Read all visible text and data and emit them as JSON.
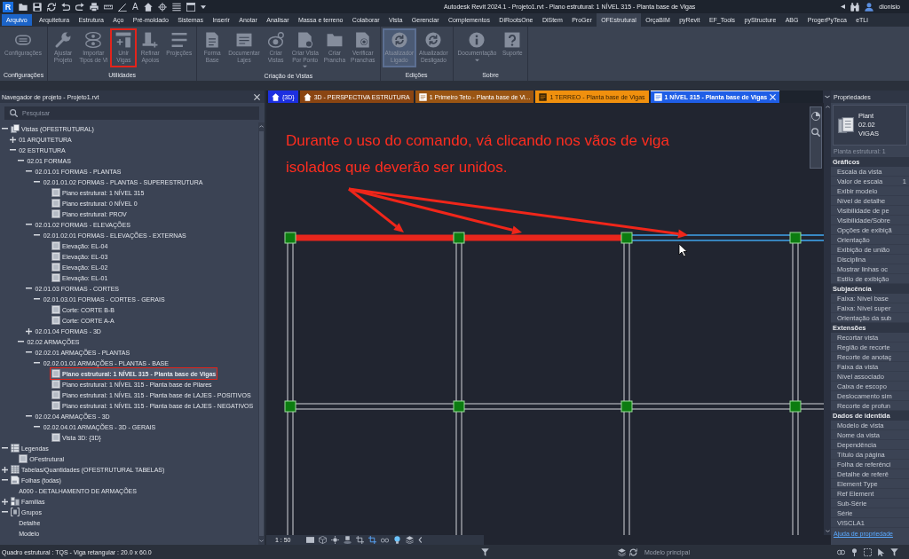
{
  "title_bar": {
    "logo": "R",
    "text_tool": "A",
    "title": "Autodesk Revit 2024.1 - Projeto1.rvt - Plano estrutural: 1 NÍVEL 315 - Planta base de Vigas",
    "user": "dionisio"
  },
  "menu": {
    "file_button": "Arquivo",
    "tabs": [
      {
        "label": "Arquitetura",
        "selected": false
      },
      {
        "label": "Estrutura",
        "selected": false
      },
      {
        "label": "Aço",
        "selected": false
      },
      {
        "label": "Pré-moldado",
        "selected": false
      },
      {
        "label": "Sistemas",
        "selected": false
      },
      {
        "label": "Inserir",
        "selected": false
      },
      {
        "label": "Anotar",
        "selected": false
      },
      {
        "label": "Analisar",
        "selected": false
      },
      {
        "label": "Massa e terreno",
        "selected": false
      },
      {
        "label": "Colaborar",
        "selected": false
      },
      {
        "label": "Vista",
        "selected": false
      },
      {
        "label": "Gerenciar",
        "selected": false
      },
      {
        "label": "Complementos",
        "selected": false
      },
      {
        "label": "DiRootsOne",
        "selected": false
      },
      {
        "label": "DiStem",
        "selected": false
      },
      {
        "label": "ProGer",
        "selected": false
      },
      {
        "label": "OFEstrutural",
        "selected": true
      },
      {
        "label": "OrçaBIM",
        "selected": false
      },
      {
        "label": "pyRevit",
        "selected": false
      },
      {
        "label": "EF_Tools",
        "selected": false
      },
      {
        "label": "pyStructure",
        "selected": false
      },
      {
        "label": "ABG",
        "selected": false
      },
      {
        "label": "ProgerPyTeca",
        "selected": false
      },
      {
        "label": "eTLi",
        "selected": false
      }
    ]
  },
  "ribbon": {
    "panels": [
      {
        "title": "Configurações",
        "buttons": [
          {
            "label": "Configurações",
            "disabled": true,
            "pressed": false,
            "annotated": false,
            "menu": false
          }
        ]
      },
      {
        "title": "Utilidades",
        "buttons": [
          {
            "label": "Ajustar\nProjeto",
            "disabled": true,
            "pressed": false,
            "annotated": false,
            "menu": false
          },
          {
            "label": "Importar\nTipos de Vi",
            "disabled": true,
            "pressed": false,
            "annotated": false,
            "menu": false
          },
          {
            "label": "Unir\nVigas",
            "disabled": true,
            "pressed": false,
            "annotated": true,
            "menu": false
          },
          {
            "label": "Refinar\nApoios",
            "disabled": true,
            "pressed": false,
            "annotated": false,
            "menu": false
          },
          {
            "label": "Projeções",
            "disabled": true,
            "pressed": false,
            "annotated": false,
            "menu": false
          }
        ]
      },
      {
        "title": "Criação de Vistas",
        "buttons": [
          {
            "label": "Forma\nBase",
            "disabled": true,
            "pressed": false,
            "annotated": false,
            "menu": false
          },
          {
            "label": "Documentar\nLajes",
            "disabled": true,
            "pressed": false,
            "annotated": false,
            "menu": false
          },
          {
            "label": "Criar\nVistas",
            "disabled": true,
            "pressed": false,
            "annotated": false,
            "menu": false
          },
          {
            "label": "Criar Vista\nPor Ponto",
            "disabled": true,
            "pressed": false,
            "annotated": false,
            "menu": true
          },
          {
            "label": "Criar\nPrancha",
            "disabled": true,
            "pressed": false,
            "annotated": false,
            "menu": false
          },
          {
            "label": "Verificar\nPranchas",
            "disabled": true,
            "pressed": false,
            "annotated": false,
            "menu": false
          }
        ]
      },
      {
        "title": "Edições",
        "buttons": [
          {
            "label": "Atualizador\nLigado",
            "disabled": true,
            "pressed": true,
            "annotated": false,
            "menu": false
          },
          {
            "label": "Atualizador\nDesligado",
            "disabled": true,
            "pressed": false,
            "annotated": false,
            "menu": false
          }
        ]
      },
      {
        "title": "Sobre",
        "buttons": [
          {
            "label": "Documentação",
            "disabled": true,
            "pressed": false,
            "annotated": false,
            "menu": true
          },
          {
            "label": "Suporte",
            "disabled": true,
            "pressed": false,
            "annotated": false,
            "menu": false
          }
        ]
      }
    ]
  },
  "project_browser": {
    "title": "Navegador de projeto - Projeto1.rvt",
    "search": {
      "placeholder": "Pesquisar"
    },
    "tree": [
      {
        "label": "Vistas (OFESTRUTURAL)",
        "kind": "category",
        "expanded": true,
        "selected": false,
        "children": [
          {
            "label": "01 ARQUITETURA",
            "kind": "plain",
            "expanded": false,
            "selected": false
          },
          {
            "label": "02 ESTRUTURA",
            "kind": "plain",
            "expanded": true,
            "selected": false,
            "children": [
              {
                "label": "02.01 FORMAS",
                "kind": "plain",
                "expanded": true,
                "selected": false,
                "children": [
                  {
                    "label": "02.01.01 FORMAS - PLANTAS",
                    "kind": "plain",
                    "expanded": true,
                    "selected": false,
                    "children": [
                      {
                        "label": "02.01.01.02 FORMAS - PLANTAS - SUPERESTRUTURA",
                        "kind": "plain",
                        "expanded": true,
                        "selected": false,
                        "children": [
                          {
                            "label": "Plano estrutural: 1 NÍVEL 315",
                            "kind": "view",
                            "selected": false
                          },
                          {
                            "label": "Plano estrutural: 0 NÍVEL 0",
                            "kind": "view",
                            "selected": false
                          },
                          {
                            "label": "Plano estrutural: PROV",
                            "kind": "view",
                            "selected": false
                          }
                        ]
                      }
                    ]
                  },
                  {
                    "label": "02.01.02 FORMAS - ELEVAÇÕES",
                    "kind": "plain",
                    "expanded": true,
                    "selected": false,
                    "children": [
                      {
                        "label": "02.01.02.01 FORMAS - ELEVAÇÕES - EXTERNAS",
                        "kind": "plain",
                        "expanded": true,
                        "selected": false,
                        "children": [
                          {
                            "label": "Elevação: EL-04",
                            "kind": "view",
                            "selected": false
                          },
                          {
                            "label": "Elevação: EL-03",
                            "kind": "view",
                            "selected": false
                          },
                          {
                            "label": "Elevação: EL-02",
                            "kind": "view",
                            "selected": false
                          },
                          {
                            "label": "Elevação: EL-01",
                            "kind": "view",
                            "selected": false
                          }
                        ]
                      }
                    ]
                  },
                  {
                    "label": "02.01.03 FORMAS - CORTES",
                    "kind": "plain",
                    "expanded": true,
                    "selected": false,
                    "children": [
                      {
                        "label": "02.01.03.01 FORMAS - CORTES - GERAIS",
                        "kind": "plain",
                        "expanded": true,
                        "selected": false,
                        "children": [
                          {
                            "label": "Corte: CORTE B-B",
                            "kind": "view",
                            "selected": false
                          },
                          {
                            "label": "Corte: CORTE A-A",
                            "kind": "view",
                            "selected": false
                          }
                        ]
                      }
                    ]
                  },
                  {
                    "label": "02.01.04 FORMAS - 3D",
                    "kind": "plain",
                    "expanded": false,
                    "selected": false
                  }
                ]
              },
              {
                "label": "02.02 ARMAÇÕES",
                "kind": "plain",
                "expanded": true,
                "selected": false,
                "children": [
                  {
                    "label": "02.02.01 ARMAÇÕES - PLANTAS",
                    "kind": "plain",
                    "expanded": true,
                    "selected": false,
                    "children": [
                      {
                        "label": "02.02.01.01 ARMAÇÕES - PLANTAS - BASE",
                        "kind": "plain",
                        "expanded": true,
                        "selected": false,
                        "children": [
                          {
                            "label": "Plano estrutural: 1 NÍVEL 315 - Planta base de Vigas",
                            "kind": "view",
                            "selected": true
                          },
                          {
                            "label": "Plano estrutural: 1 NÍVEL 315 - Planta base de Pilares",
                            "kind": "view",
                            "selected": false
                          },
                          {
                            "label": "Plano estrutural: 1 NÍVEL 315 - Planta base de LAJES - POSITIVOS",
                            "kind": "view",
                            "selected": false
                          },
                          {
                            "label": "Plano estrutural: 1 NÍVEL 315 - Planta base de LAJES - NEGATIVOS",
                            "kind": "view",
                            "selected": false
                          }
                        ]
                      }
                    ]
                  },
                  {
                    "label": "02.02.04 ARMAÇÕES - 3D",
                    "kind": "plain",
                    "expanded": true,
                    "selected": false,
                    "children": [
                      {
                        "label": "02.02.04.01 ARMAÇÕES - 3D - GERAIS",
                        "kind": "plain",
                        "expanded": true,
                        "selected": false,
                        "children": [
                          {
                            "label": "Vista 3D: {3D}",
                            "kind": "view",
                            "selected": false
                          }
                        ]
                      }
                    ]
                  }
                ]
              }
            ]
          }
        ]
      },
      {
        "label": "Legendas",
        "kind": "category",
        "expanded": true,
        "selected": false,
        "children": [
          {
            "label": "OFestrutural",
            "kind": "view",
            "selected": false
          }
        ]
      },
      {
        "label": "Tabelas/Quantidades (OFESTRUTURAL TABELAS)",
        "kind": "category",
        "expanded": false,
        "selected": false
      },
      {
        "label": "Folhas (todas)",
        "kind": "category",
        "expanded": true,
        "selected": false,
        "children": [
          {
            "label": "A000 - DETALHAMENTO DE ARMAÇÕES",
            "kind": "plain",
            "selected": false
          }
        ]
      },
      {
        "label": "Famílias",
        "kind": "category",
        "expanded": false,
        "selected": false
      },
      {
        "label": "Grupos",
        "kind": "category",
        "expanded": true,
        "selected": false,
        "children": [
          {
            "label": "Detalhe",
            "kind": "plain",
            "selected": false
          },
          {
            "label": "Modelo",
            "kind": "plain",
            "selected": false
          }
        ]
      }
    ]
  },
  "view": {
    "tabs": [
      {
        "label": "{3D}",
        "color": "#1c2fe0",
        "selected": false
      },
      {
        "label": "3D - PERSPECTIVA ESTRUTURA",
        "color": "#8a4512",
        "selected": false
      },
      {
        "label": "1 Primeiro Teto - Planta base de Vi...",
        "color": "#9a5513",
        "selected": false
      },
      {
        "label": "1 TERREO - Planta base de Vigas",
        "color": "#f0900e",
        "selected": false
      },
      {
        "label": "1 NÍVEL 315 - Planta base de Vigas",
        "color": "#1f5ee6",
        "selected": true
      }
    ],
    "annotation": "Durante o uso do comando, vá clicando nos vãos de viga isolados que deverão ser unidos.",
    "beam_spans": [
      {
        "selected": true,
        "hovered": false
      },
      {
        "selected": true,
        "hovered": false
      },
      {
        "selected": false,
        "hovered": true
      },
      {
        "selected": false,
        "hovered": true
      }
    ],
    "scale": "1 : 50"
  },
  "properties": {
    "title": "Propriedades",
    "type_lines": [
      "Plant",
      "02.02",
      "VIGAS"
    ],
    "instance_selector": "Planta estrutural: 1",
    "sections": [
      {
        "title": "Gráficos",
        "rows": [
          {
            "label": "Escala da vista"
          },
          {
            "label": "Valor de escala",
            "value": "1"
          },
          {
            "label": "Exibir modelo"
          },
          {
            "label": "Nível de detalhe"
          },
          {
            "label": "Visibilidade de pe"
          },
          {
            "label": "Visibilidade/Sobre"
          },
          {
            "label": "Opções de exibiçã"
          },
          {
            "label": "Orientação"
          },
          {
            "label": "Exibição de união"
          },
          {
            "label": "Disciplina"
          },
          {
            "label": "Mostrar linhas oc"
          },
          {
            "label": "Estilo de exibição"
          }
        ]
      },
      {
        "title": "Subjacência",
        "rows": [
          {
            "label": "Faixa: Nível base"
          },
          {
            "label": "Faixa: Nível super"
          },
          {
            "label": "Orientação da sub"
          }
        ]
      },
      {
        "title": "Extensões",
        "rows": [
          {
            "label": "Recortar vista"
          },
          {
            "label": "Região de recorte"
          },
          {
            "label": "Recorte de anotaç"
          },
          {
            "label": "Faixa da vista"
          },
          {
            "label": "Nível associado"
          },
          {
            "label": "Caixa de escopo"
          },
          {
            "label": "Deslocamento sim"
          },
          {
            "label": "Recorte de profun"
          }
        ]
      },
      {
        "title": "Dados de identida",
        "rows": [
          {
            "label": "Modelo de vista"
          },
          {
            "label": "Nome da vista"
          },
          {
            "label": "Dependência"
          },
          {
            "label": "Título da página"
          },
          {
            "label": "Folha de referênci"
          },
          {
            "label": "Detalhe de referê"
          },
          {
            "label": "Element Type"
          },
          {
            "label": "Ref Element"
          },
          {
            "label": "Sub-Série"
          },
          {
            "label": "Série"
          },
          {
            "label": "VISCLA1"
          }
        ]
      }
    ],
    "help_link": "Ajuda de propriedade"
  },
  "status_bar": {
    "message": "Quadro estrutural : TQS - Viga retangular : 20.0 x 60.0",
    "workset": "Modelo principal"
  }
}
